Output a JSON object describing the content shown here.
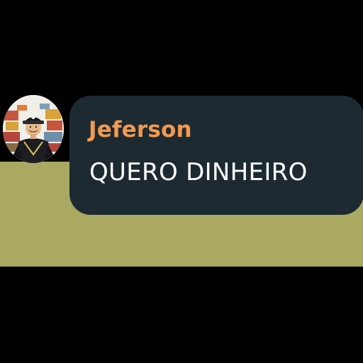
{
  "chat": {
    "avatar_icon": "user-avatar-icon",
    "sender_name": "Jeferson",
    "message_text": "QUERO DINHEIRO"
  },
  "colors": {
    "background": "#000000",
    "band": "#a9a961",
    "bubble": "#1e2a32",
    "sender_name": "#f29a4f",
    "message_text": "#ffffff"
  }
}
